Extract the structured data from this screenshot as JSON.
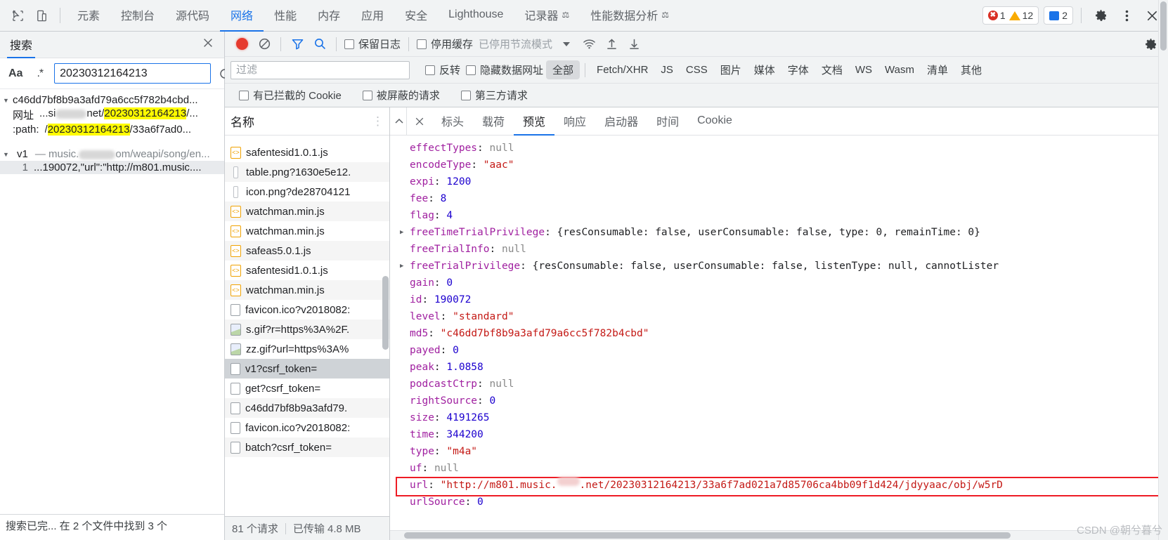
{
  "topbar": {
    "icons": [
      "inspect-element-icon",
      "device-toolbar-icon"
    ],
    "tabs": [
      {
        "label": "元素",
        "selected": false,
        "experiment": false
      },
      {
        "label": "控制台",
        "selected": false,
        "experiment": false
      },
      {
        "label": "源代码",
        "selected": false,
        "experiment": false
      },
      {
        "label": "网络",
        "selected": true,
        "experiment": false
      },
      {
        "label": "性能",
        "selected": false,
        "experiment": false
      },
      {
        "label": "内存",
        "selected": false,
        "experiment": false
      },
      {
        "label": "应用",
        "selected": false,
        "experiment": false
      },
      {
        "label": "安全",
        "selected": false,
        "experiment": false
      },
      {
        "label": "Lighthouse",
        "selected": false,
        "experiment": false
      },
      {
        "label": "记录器",
        "selected": false,
        "experiment": true
      },
      {
        "label": "性能数据分析",
        "selected": false,
        "experiment": true
      }
    ],
    "error_count": "1",
    "warning_count": "12",
    "message_count": "2",
    "settings_icon": "gear-icon",
    "more_icon": "kebab-menu-icon",
    "close_icon": "close-icon",
    "colors": {
      "accent": "#1a73e8",
      "error": "#d93025",
      "warning": "#f9ab00"
    }
  },
  "search": {
    "title": "搜索",
    "close_icon": "close-icon",
    "match_case_label": "Aa",
    "regex_label": ".*",
    "query": "20230312164213",
    "placeholder": "",
    "refresh_icon": "refresh-icon",
    "clear_icon": "clear-icon",
    "results": [
      {
        "file": "c46dd7bf8b9a3afd79a6cc5f782b4cbd...",
        "lines": [
          {
            "label": "网址",
            "pre": "...si",
            "blurred": true,
            "mid": "net/",
            "hit": "20230312164213",
            "post": "/..."
          },
          {
            "label": ":path:",
            "pre": "/",
            "blurred": false,
            "mid": "",
            "hit": "20230312164213",
            "post": "/33a6f7ad0..."
          }
        ]
      },
      {
        "file": "v1",
        "file_sub_pre": "music.",
        "file_sub_post": "om/weapi/song/en...",
        "lines": [
          {
            "num": "1",
            "text": "...190072,\"url\":\"http://m801.music...."
          }
        ]
      }
    ],
    "status": "搜索已完...  在 2 个文件中找到 3 个"
  },
  "network_toolbar": {
    "record_icon": "record-button",
    "clear_icon": "clear-icon",
    "filter_icon": "filter-funnel-icon",
    "search_icon": "search-icon",
    "preserve_log_label": "保留日志",
    "disable_cache_label": "停用缓存",
    "throttling_label": "已停用节流模式",
    "throttling_caret": "chevron-down-icon",
    "wifi_icon": "wifi-icon",
    "import_icon": "upload-arrow-icon",
    "export_icon": "download-arrow-icon",
    "settings_icon": "gear-icon",
    "filter_placeholder": "过滤",
    "invert_label": "反转",
    "hide_data_urls_label": "隐藏数据网址",
    "types": [
      "全部",
      "Fetch/XHR",
      "JS",
      "CSS",
      "图片",
      "媒体",
      "字体",
      "文档",
      "WS",
      "Wasm",
      "清单",
      "其他"
    ],
    "selected_type": "全部",
    "blocked_cookies_label": "有已拦截的 Cookie",
    "blocked_requests_label": "被屏蔽的请求",
    "third_party_label": "第三方请求"
  },
  "request_list": {
    "column_header": "名称",
    "rows": [
      {
        "name": "safentesid1.0.1.js",
        "icon": "js-file-icon",
        "selected": false
      },
      {
        "name": "table.png?1630e5e12.",
        "icon": "image-file-icon-narrow",
        "selected": false
      },
      {
        "name": "icon.png?de28704121",
        "icon": "image-file-icon-narrow",
        "selected": false
      },
      {
        "name": "watchman.min.js",
        "icon": "js-file-icon",
        "selected": false
      },
      {
        "name": "watchman.min.js",
        "icon": "js-file-icon",
        "selected": false
      },
      {
        "name": "safeas5.0.1.js",
        "icon": "js-file-icon",
        "selected": false
      },
      {
        "name": "safentesid1.0.1.js",
        "icon": "js-file-icon",
        "selected": false
      },
      {
        "name": "watchman.min.js",
        "icon": "js-file-icon",
        "selected": false
      },
      {
        "name": "favicon.ico?v2018082:",
        "icon": "document-file-icon",
        "selected": false
      },
      {
        "name": "s.gif?r=https%3A%2F.",
        "icon": "image-file-icon",
        "selected": false
      },
      {
        "name": "zz.gif?url=https%3A%",
        "icon": "image-file-icon",
        "selected": false
      },
      {
        "name": "v1?csrf_token=",
        "icon": "document-file-icon",
        "selected": true
      },
      {
        "name": "get?csrf_token=",
        "icon": "document-file-icon",
        "selected": false
      },
      {
        "name": "c46dd7bf8b9a3afd79.",
        "icon": "document-file-icon",
        "selected": false
      },
      {
        "name": "favicon.ico?v2018082:",
        "icon": "document-file-icon",
        "selected": false
      },
      {
        "name": "batch?csrf_token=",
        "icon": "document-file-icon",
        "selected": false
      }
    ],
    "footer_requests": "81 个请求",
    "footer_transferred": "已传输 4.8 MB"
  },
  "details": {
    "close_icon": "close-icon",
    "tabs": [
      {
        "label": "标头",
        "selected": false
      },
      {
        "label": "载荷",
        "selected": false
      },
      {
        "label": "预览",
        "selected": true
      },
      {
        "label": "响应",
        "selected": false
      },
      {
        "label": "启动器",
        "selected": false
      },
      {
        "label": "时间",
        "selected": false
      },
      {
        "label": "Cookie",
        "selected": false
      }
    ],
    "json_rows": [
      {
        "expandable": false,
        "key": "effectTypes",
        "value": "null",
        "vtype": "null"
      },
      {
        "expandable": false,
        "key": "encodeType",
        "value": "\"aac\"",
        "vtype": "str"
      },
      {
        "expandable": false,
        "key": "expi",
        "value": "1200",
        "vtype": "num"
      },
      {
        "expandable": false,
        "key": "fee",
        "value": "8",
        "vtype": "num"
      },
      {
        "expandable": false,
        "key": "flag",
        "value": "4",
        "vtype": "num"
      },
      {
        "expandable": true,
        "key": "freeTimeTrialPrivilege",
        "value": "{resConsumable: false, userConsumable: false, type: 0, remainTime: 0}",
        "vtype": "plain"
      },
      {
        "expandable": false,
        "key": "freeTrialInfo",
        "value": "null",
        "vtype": "null"
      },
      {
        "expandable": true,
        "key": "freeTrialPrivilege",
        "value": "{resConsumable: false, userConsumable: false, listenType: null, cannotLister",
        "vtype": "plain"
      },
      {
        "expandable": false,
        "key": "gain",
        "value": "0",
        "vtype": "num"
      },
      {
        "expandable": false,
        "key": "id",
        "value": "190072",
        "vtype": "num"
      },
      {
        "expandable": false,
        "key": "level",
        "value": "\"standard\"",
        "vtype": "str"
      },
      {
        "expandable": false,
        "key": "md5",
        "value": "\"c46dd7bf8b9a3afd79a6cc5f782b4cbd\"",
        "vtype": "str"
      },
      {
        "expandable": false,
        "key": "payed",
        "value": "0",
        "vtype": "num"
      },
      {
        "expandable": false,
        "key": "peak",
        "value": "1.0858",
        "vtype": "num"
      },
      {
        "expandable": false,
        "key": "podcastCtrp",
        "value": "null",
        "vtype": "null"
      },
      {
        "expandable": false,
        "key": "rightSource",
        "value": "0",
        "vtype": "num"
      },
      {
        "expandable": false,
        "key": "size",
        "value": "4191265",
        "vtype": "num"
      },
      {
        "expandable": false,
        "key": "time",
        "value": "344200",
        "vtype": "num"
      },
      {
        "expandable": false,
        "key": "type",
        "value": "\"m4a\"",
        "vtype": "str"
      },
      {
        "expandable": false,
        "key": "uf",
        "value": "null",
        "vtype": "null"
      }
    ],
    "highlighted_row": {
      "key": "url",
      "value_pre": "\"http://m801.music.",
      "value_post": ".net/20230312164213/33a6f7ad021a7d85706ca4bb09f1d424/jdyyaac/obj/w5rD",
      "box_color": "#ee1c25"
    },
    "last_row": {
      "key": "urlSource",
      "value": "0",
      "vtype": "num"
    }
  },
  "watermark": "CSDN @朝兮暮兮"
}
